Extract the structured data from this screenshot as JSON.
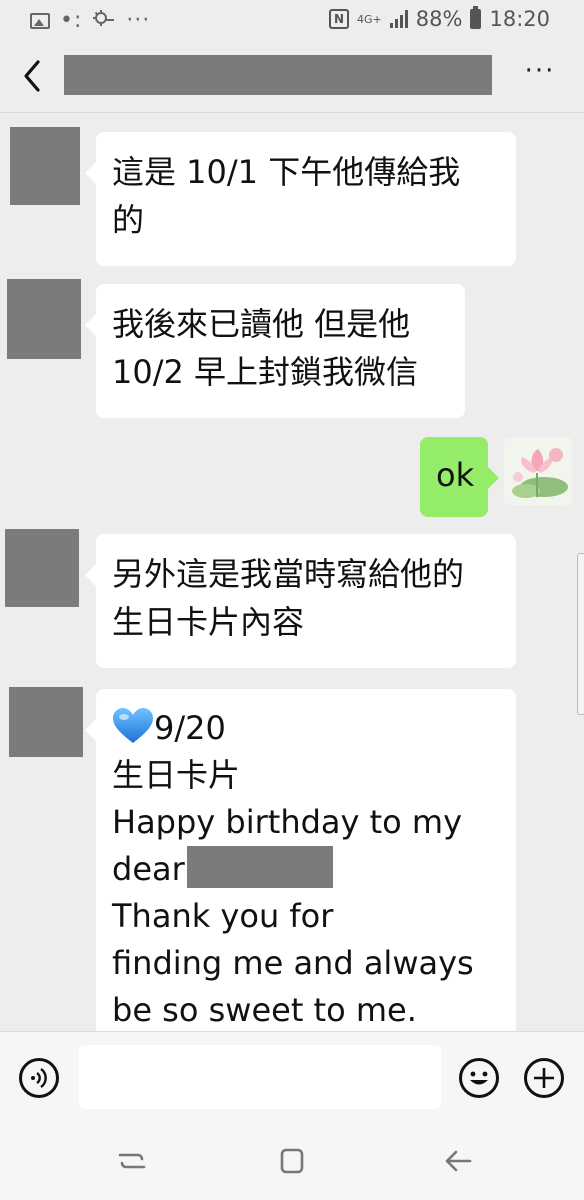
{
  "status_bar": {
    "network": "4G+",
    "battery": "88%",
    "time": "18:20"
  },
  "header": {
    "back_icon": "chevron-left-icon",
    "more_label": "···"
  },
  "messages": [
    {
      "side": "left",
      "lines": [
        "這是 10/1 下午他傳給我",
        "的"
      ]
    },
    {
      "side": "left",
      "lines": [
        "我後來已讀他 但是他",
        "10/2 早上封鎖我微信"
      ]
    },
    {
      "side": "right",
      "lines": [
        "ok"
      ]
    },
    {
      "side": "left",
      "lines": [
        "另外這是我當時寫給他的",
        "生日卡片內容"
      ]
    },
    {
      "side": "left",
      "lines": [
        "9/20",
        "生日卡片",
        "Happy birthday to my",
        "dear",
        "Thank you for",
        "finding me and always",
        "be so sweet to me."
      ]
    }
  ],
  "colors": {
    "background": "#ededed",
    "incoming_bubble": "#ffffff",
    "outgoing_bubble": "#95ec69",
    "redaction": "#7b7b7b"
  },
  "input_bar": {
    "voice_icon": "voice-icon",
    "emoji_icon": "emoji-icon",
    "plus_icon": "plus-icon",
    "placeholder": ""
  },
  "nav_bar": {
    "recent_icon": "recent-apps-icon",
    "home_icon": "home-icon",
    "back_icon": "back-arrow-icon"
  }
}
